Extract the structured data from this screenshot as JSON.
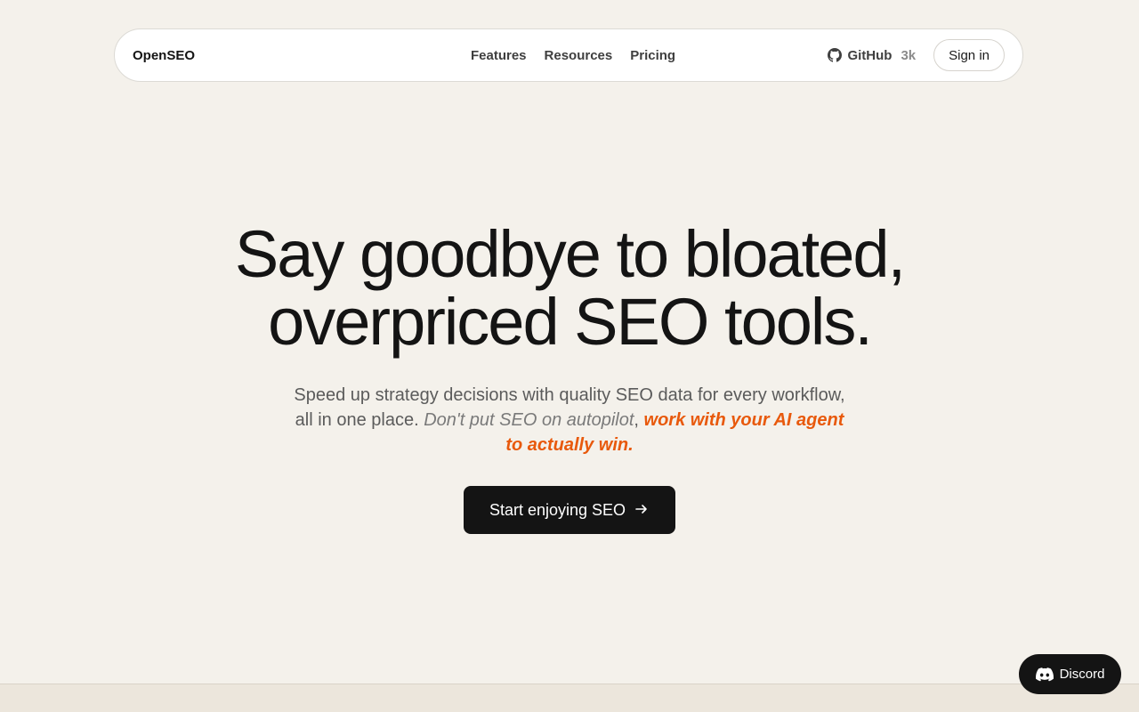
{
  "nav": {
    "brand": "OpenSEO",
    "links": [
      "Features",
      "Resources",
      "Pricing"
    ],
    "github_label": "GitHub",
    "github_count": "3k",
    "signin_label": "Sign in"
  },
  "hero": {
    "headline_line1": "Say goodbye to bloated,",
    "headline_line2": "overpriced SEO tools.",
    "sub_plain": "Speed up strategy decisions with quality SEO data for every workflow, all in one place.",
    "sub_italic": "Don't put SEO on autopilot",
    "sub_comma": ",",
    "sub_accent": "work with your AI agent to actually win.",
    "cta_label": "Start enjoying SEO",
    "cta_icon": "arrow-right-icon"
  },
  "floating": {
    "discord_label": "Discord",
    "discord_icon": "discord-icon"
  },
  "colors": {
    "background": "#f4f1eb",
    "accent": "#e8590c",
    "dark": "#141414"
  }
}
